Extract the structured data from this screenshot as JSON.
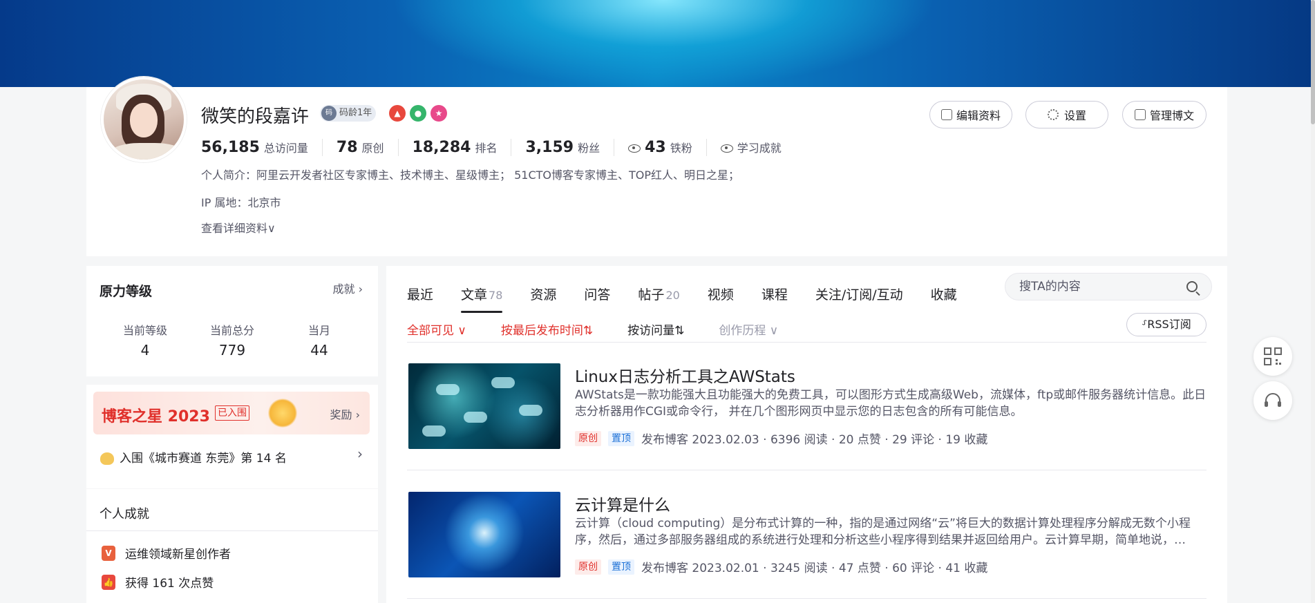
{
  "profile": {
    "name": "微笑的段嘉许",
    "code_age": "码龄1年",
    "stats": [
      {
        "num": "56,185",
        "label": "总访问量"
      },
      {
        "num": "78",
        "label": "原创"
      },
      {
        "num": "18,284",
        "label": "排名"
      },
      {
        "num": "3,159",
        "label": "粉丝"
      },
      {
        "num": "43",
        "label": "铁粉"
      }
    ],
    "learning": "学习成就",
    "intro": "个人简介：阿里云开发者社区专家博主、技术博主、星级博主； 51CTO博客专家博主、TOP红人、明日之星；",
    "ip": "IP 属地：北京市",
    "more": "查看详细资料∨",
    "buttons": {
      "edit": "编辑资料",
      "settings": "设置",
      "manage": "管理博文"
    }
  },
  "rank": {
    "title": "原力等级",
    "link": "成就 ›",
    "cells": [
      {
        "label": "当前等级",
        "value": "4"
      },
      {
        "label": "当前总分",
        "value": "779"
      },
      {
        "label": "当月",
        "value": "44"
      }
    ]
  },
  "star": {
    "title": "博客之星 2023",
    "tag": "已入围",
    "reward": "奖励 ›",
    "entry": "入围《城市赛道 东莞》第 14 名"
  },
  "achievements": {
    "title": "个人成就",
    "items": [
      "运维领域新星创作者",
      "获得 161 次点赞"
    ]
  },
  "tabs": [
    {
      "label": "最近",
      "count": ""
    },
    {
      "label": "文章",
      "count": "78"
    },
    {
      "label": "资源",
      "count": ""
    },
    {
      "label": "问答",
      "count": ""
    },
    {
      "label": "帖子",
      "count": "20"
    },
    {
      "label": "视频",
      "count": ""
    },
    {
      "label": "课程",
      "count": ""
    },
    {
      "label": "关注/订阅/互动",
      "count": ""
    },
    {
      "label": "收藏",
      "count": ""
    }
  ],
  "search": {
    "placeholder": "搜TA的内容"
  },
  "filters": {
    "visibility": "全部可见 ∨",
    "sort_time": "按最后发布时间⇅",
    "sort_views": "按访问量⇅",
    "history": "创作历程 ∨",
    "rss": "RSS订阅"
  },
  "articles": [
    {
      "title": "Linux日志分析工具之AWStats",
      "desc": " AWStats是一款功能强大且功能强大的免费工具，可以图形方式生成高级Web，流媒体，ftp或邮件服务器统计信息。此日志分析器用作CGI或命令行， 并在几个图形网页中显示您的日志包含的所有可能信息。",
      "tag1": "原创",
      "tag2": "置顶",
      "meta": "发布博客 2023.02.03 · 6396 阅读 · 20 点赞 · 29 评论 · 19 收藏"
    },
    {
      "title": "云计算是什么",
      "desc": "云计算（cloud computing）是分布式计算的一种，指的是通过网络“云”将巨大的数据计算处理程序分解成无数个小程序，然后，通过多部服务器组成的系统进行处理和分析这些小程序得到结果并返回给用户。云计算早期，简单地说，…",
      "tag1": "原创",
      "tag2": "置顶",
      "meta": "发布博客 2023.02.01 · 3245 阅读 · 47 点赞 · 60 评论 · 41 收藏"
    }
  ],
  "colors": {
    "accent_red": "#e0302b",
    "tag_blue": "#1a6fd6",
    "banner_blue": "#0a86c8"
  },
  "icons": [
    "qr-code-icon",
    "headset-icon",
    "search-icon",
    "gear-icon",
    "edit-icon",
    "manage-icon",
    "eye-icon"
  ]
}
